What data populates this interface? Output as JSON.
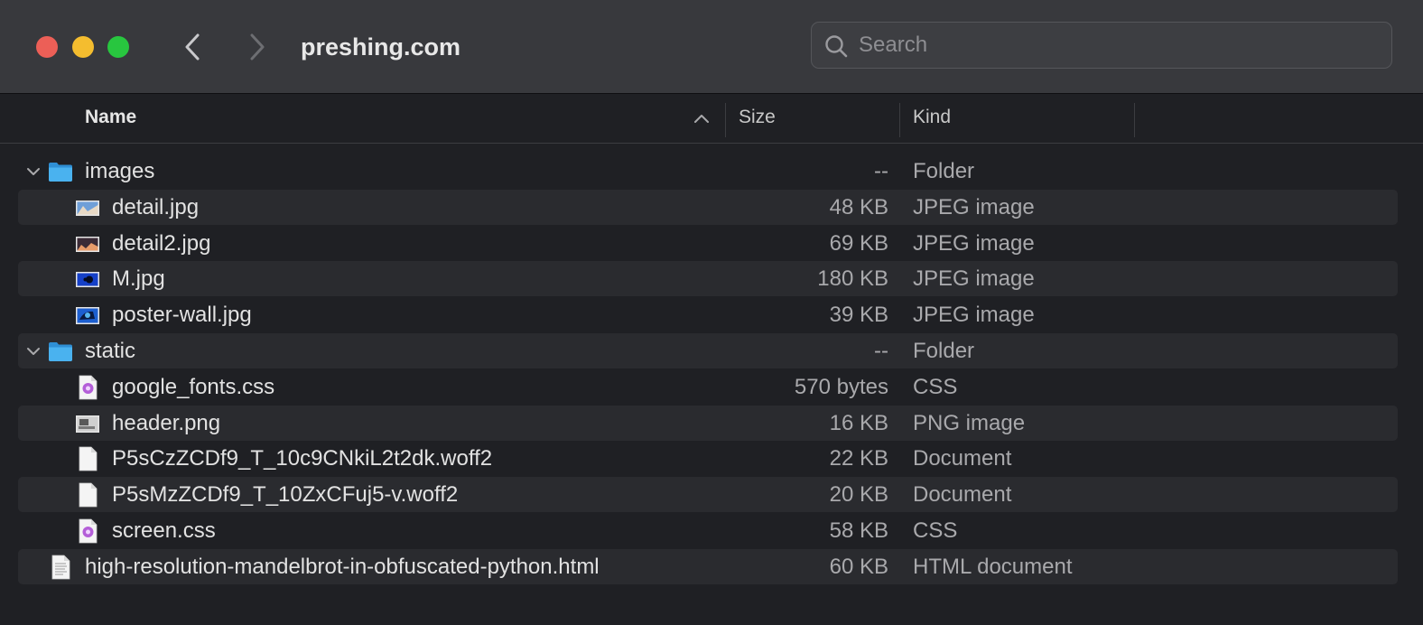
{
  "window": {
    "title": "preshing.com"
  },
  "search": {
    "placeholder": "Search",
    "value": ""
  },
  "columns": {
    "name": "Name",
    "size": "Size",
    "kind": "Kind"
  },
  "colors": {
    "titlebar": "#38393d",
    "background": "#1f2024",
    "row_alt": "#2a2b2f",
    "folder_blue": "#3fa8ea",
    "close": "#ec5f57",
    "minimize": "#f4bd2f",
    "zoom": "#28c63f"
  },
  "rows": [
    {
      "name": "images",
      "size": "--",
      "kind": "Folder",
      "icon": "folder-icon",
      "expanded": true
    },
    {
      "name": "detail.jpg",
      "size": "48 KB",
      "kind": "JPEG image",
      "icon": "jpeg-thumbnail-icon"
    },
    {
      "name": "detail2.jpg",
      "size": "69 KB",
      "kind": "JPEG image",
      "icon": "jpeg-thumbnail-icon"
    },
    {
      "name": "M.jpg",
      "size": "180 KB",
      "kind": "JPEG image",
      "icon": "jpeg-thumbnail-icon"
    },
    {
      "name": "poster-wall.jpg",
      "size": "39 KB",
      "kind": "JPEG image",
      "icon": "jpeg-thumbnail-icon"
    },
    {
      "name": "static",
      "size": "--",
      "kind": "Folder",
      "icon": "folder-icon",
      "expanded": true
    },
    {
      "name": "google_fonts.css",
      "size": "570 bytes",
      "kind": "CSS",
      "icon": "css-file-icon"
    },
    {
      "name": "header.png",
      "size": "16 KB",
      "kind": "PNG image",
      "icon": "png-thumbnail-icon"
    },
    {
      "name": "P5sCzZCDf9_T_10c9CNkiL2t2dk.woff2",
      "size": "22 KB",
      "kind": "Document",
      "icon": "document-icon"
    },
    {
      "name": "P5sMzZCDf9_T_10ZxCFuj5-v.woff2",
      "size": "20 KB",
      "kind": "Document",
      "icon": "document-icon"
    },
    {
      "name": "screen.css",
      "size": "58 KB",
      "kind": "CSS",
      "icon": "css-file-icon"
    },
    {
      "name": "high-resolution-mandelbrot-in-obfuscated-python.html",
      "size": "60 KB",
      "kind": "HTML document",
      "icon": "html-file-icon"
    }
  ]
}
